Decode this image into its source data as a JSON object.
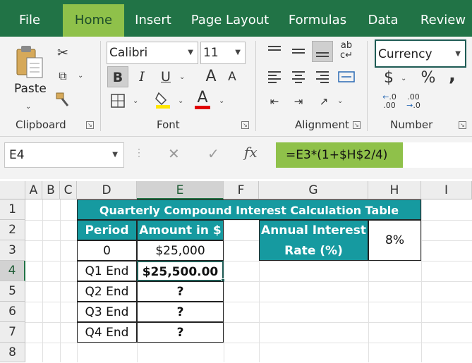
{
  "menu": {
    "tabs": [
      "File",
      "Home",
      "Insert",
      "Page Layout",
      "Formulas",
      "Data",
      "Review"
    ],
    "active": "Home"
  },
  "ribbon": {
    "clipboard": {
      "paste_label": "Paste",
      "group_label": "Clipboard"
    },
    "font": {
      "font_name": "Calibri",
      "font_size": "11",
      "bold": "B",
      "italic": "I",
      "underline": "U",
      "grow": "A",
      "shrink": "A",
      "font_color_glyph": "A",
      "group_label": "Font",
      "fill_color": "#ffe600",
      "font_color": "#e00000"
    },
    "alignment": {
      "group_label": "Alignment"
    },
    "number": {
      "format": "Currency",
      "currency": "$",
      "percent": "%",
      "comma": "9",
      "inc_decimal": "←.0 .00",
      "dec_decimal": ".00 →.0",
      "group_label": "Number"
    }
  },
  "formula_bar": {
    "name_box": "E4",
    "cancel": "✕",
    "enter": "✓",
    "fx": "fx",
    "formula": "=E3*(1+$H$2/4)"
  },
  "columns": [
    "A",
    "B",
    "C",
    "D",
    "E",
    "F",
    "G",
    "H",
    "I"
  ],
  "rows": [
    "1",
    "2",
    "3",
    "4",
    "5",
    "6",
    "7",
    "8"
  ],
  "sheet": {
    "title": "Quarterly Compound Interest Calculation Table",
    "headers": {
      "period": "Period",
      "amount": "Amount in $"
    },
    "data": [
      {
        "period": "0",
        "amount": "$25,000"
      },
      {
        "period": "Q1 End",
        "amount": "$25,500.00"
      },
      {
        "period": "Q2 End",
        "amount": "?"
      },
      {
        "period": "Q3 End",
        "amount": "?"
      },
      {
        "period": "Q4 End",
        "amount": "?"
      }
    ],
    "rate_label_line1": "Annual Interest",
    "rate_label_line2": "Rate (%)",
    "rate_value": "8%"
  },
  "colors": {
    "excel_green": "#217346",
    "highlight_green": "#8fc14a",
    "teal": "#169aa0"
  }
}
